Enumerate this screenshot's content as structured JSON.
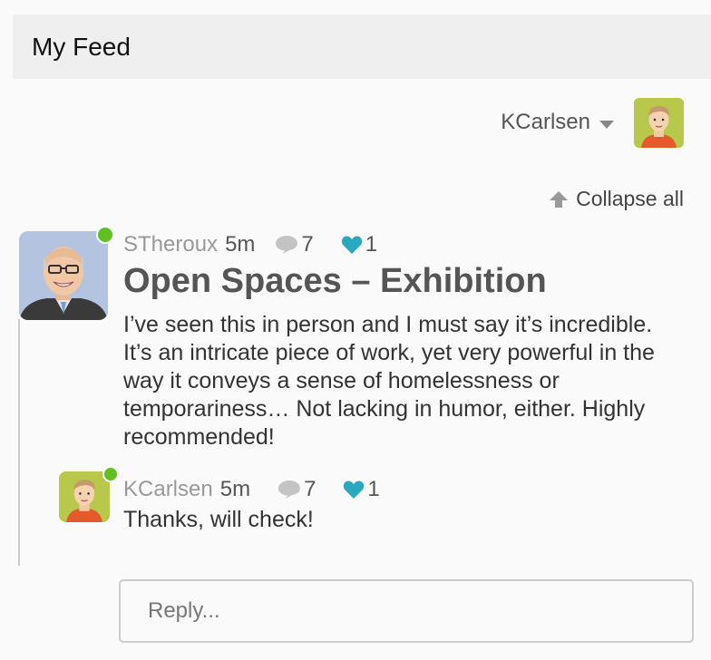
{
  "header": {
    "title": "My Feed"
  },
  "user_menu": {
    "username": "KCarlsen"
  },
  "toolbar": {
    "collapse_label": "Collapse all"
  },
  "post": {
    "author": "STheroux",
    "time": "5m",
    "comment_count": "7",
    "like_count": "1",
    "title": "Open Spaces – Exhibition",
    "body": "I’ve seen this in person and I must say it’s incredible. It’s an intricate piece of work, yet very powerful in the way it conveys a sense of homelessness or temporariness… Not lacking in humor, either. Highly recommended!"
  },
  "reply": {
    "author": "KCarlsen",
    "time": "5m",
    "comment_count": "7",
    "like_count": "1",
    "text": "Thanks, will check!"
  },
  "reply_box": {
    "placeholder": "Reply..."
  },
  "colors": {
    "online": "#5ec120",
    "heart": "#2aa8bd",
    "header_bg": "#efefef"
  }
}
